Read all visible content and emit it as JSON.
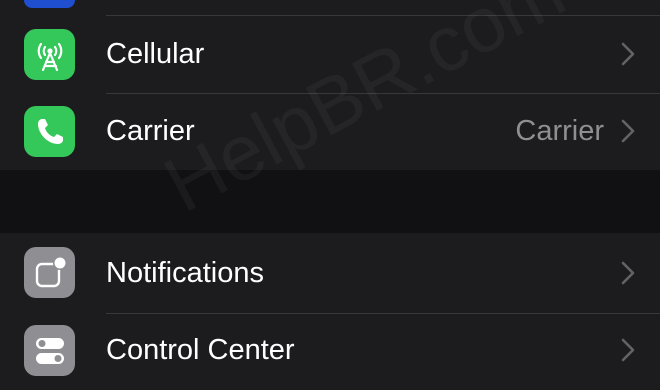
{
  "rows": [
    {
      "label": "Cellular",
      "value": "",
      "icon": "cellular-antenna-icon",
      "icon_bg": "#34c759"
    },
    {
      "label": "Carrier",
      "value": "Carrier",
      "icon": "phone-icon",
      "icon_bg": "#34c759"
    },
    {
      "label": "Notifications",
      "value": "",
      "icon": "notifications-icon",
      "icon_bg": "#8e8e93"
    },
    {
      "label": "Control Center",
      "value": "",
      "icon": "control-center-icon",
      "icon_bg": "#8e8e93"
    }
  ],
  "watermark": "HelpBR.com",
  "colors": {
    "background": "#1c1c1e",
    "section_gap": "#111113",
    "green": "#34c759",
    "gray_icon": "#8e8e93",
    "separator": "#38383a",
    "chevron": "#636366",
    "value_text": "#8e8e93"
  }
}
